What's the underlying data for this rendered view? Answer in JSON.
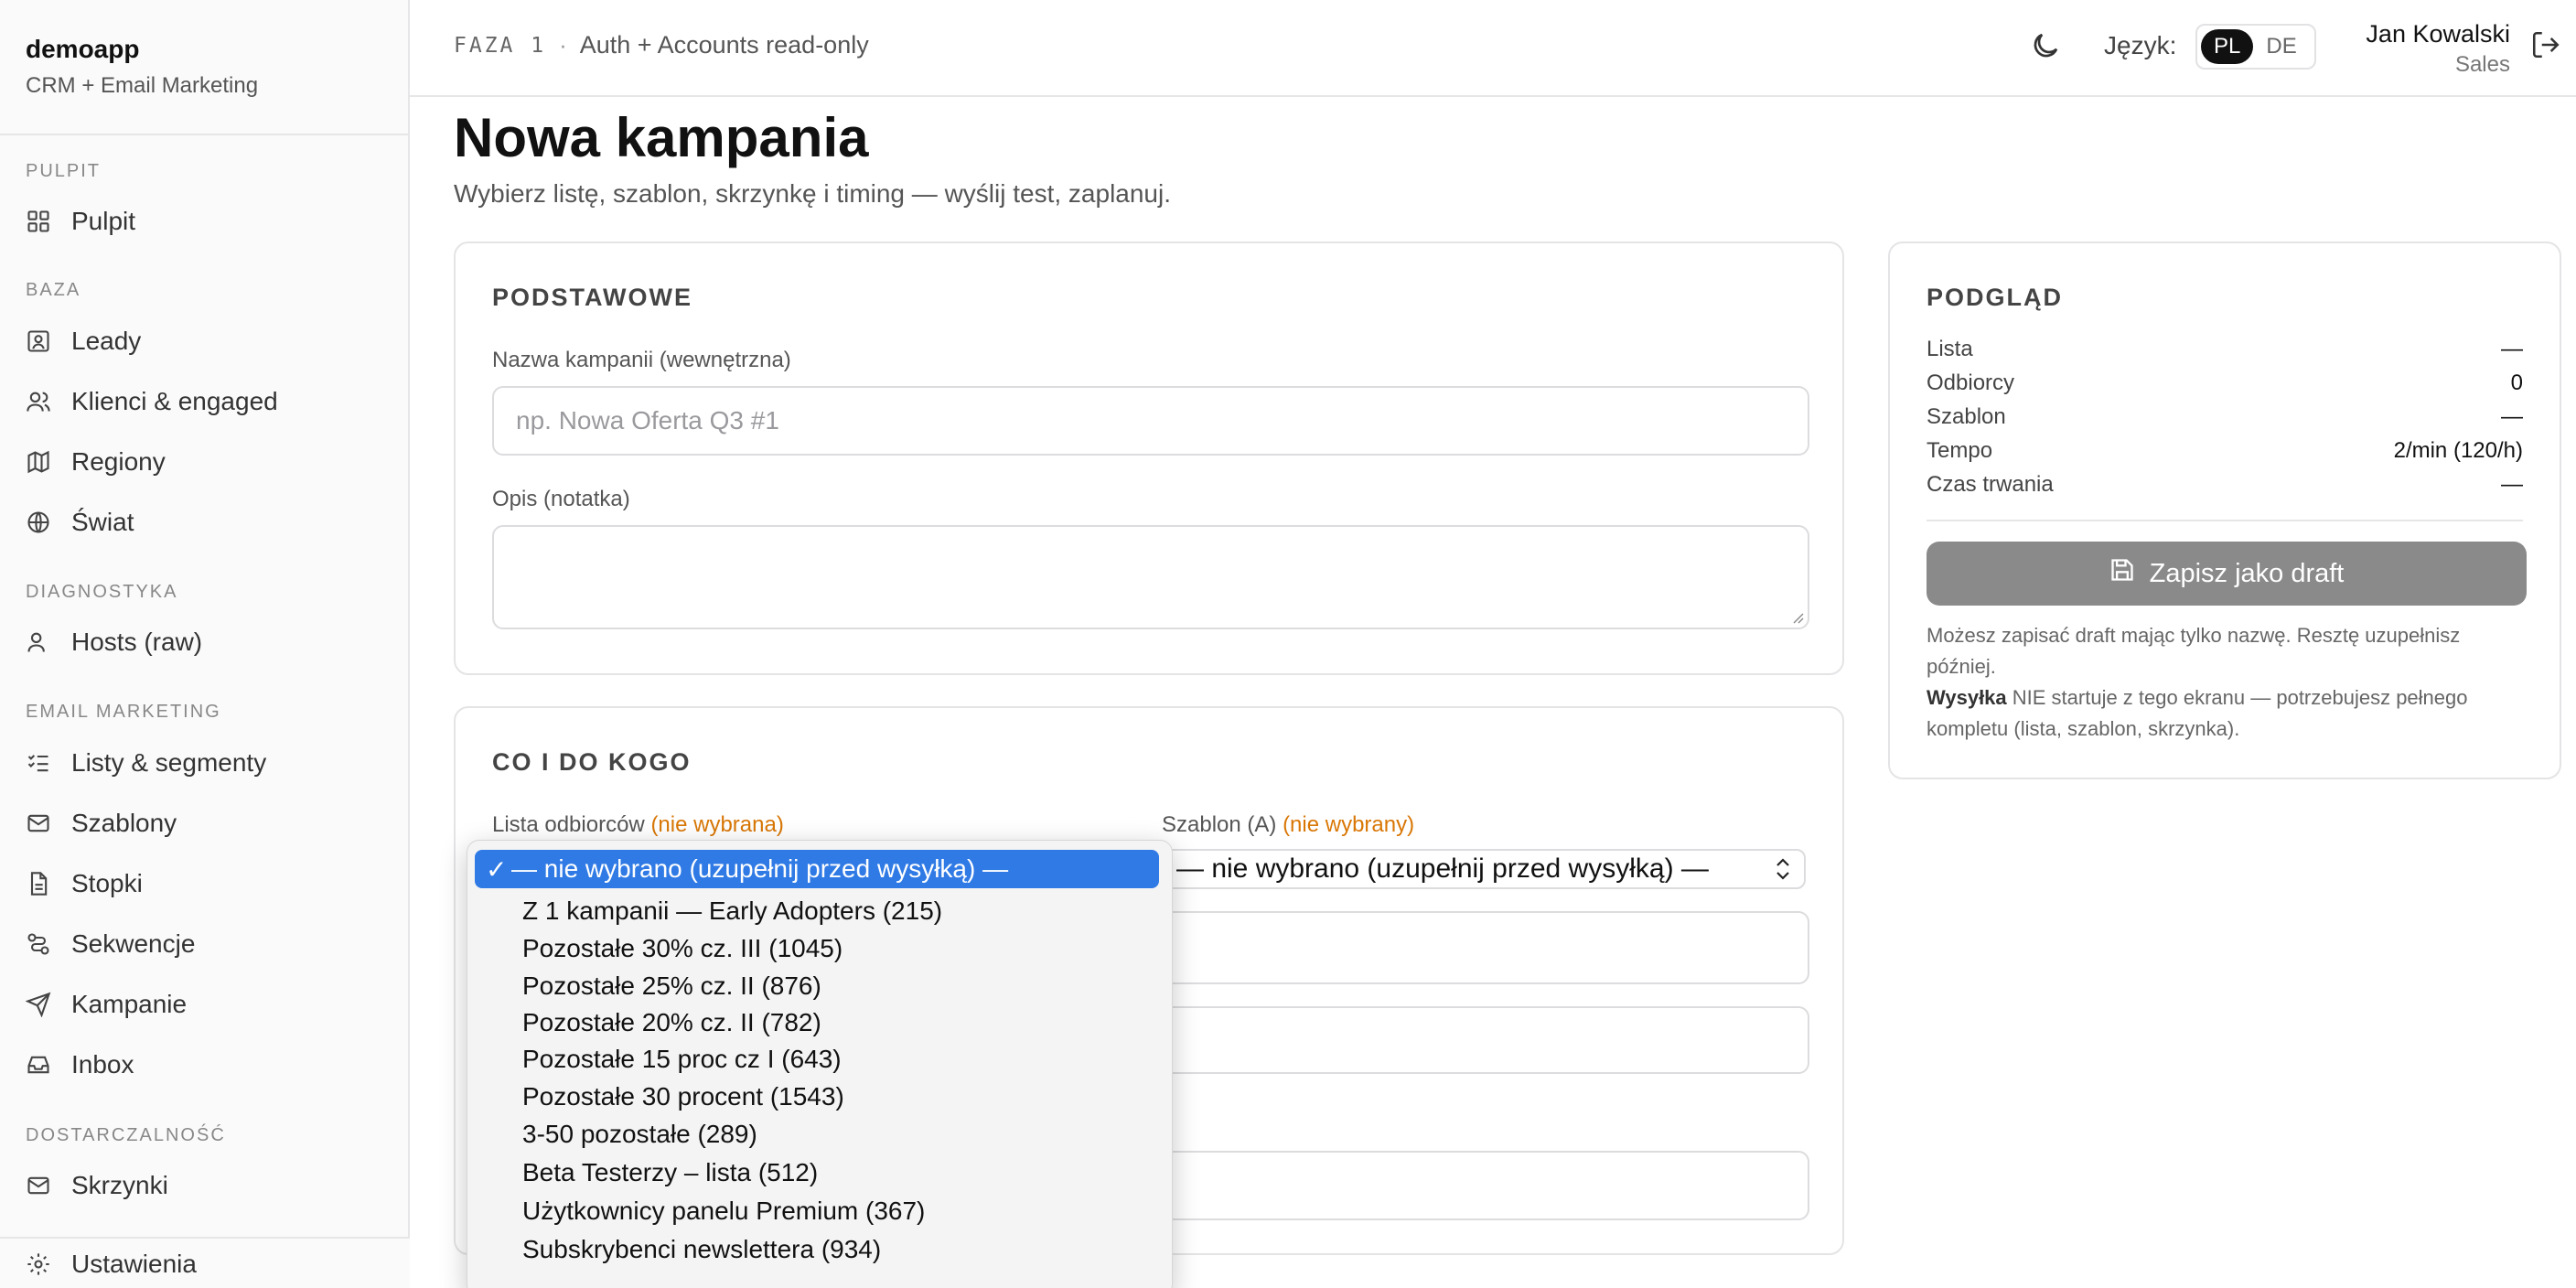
{
  "brand": {
    "name": "demoapp",
    "subtitle": "CRM + Email Marketing"
  },
  "sidebar": {
    "sections": [
      "Pulpit",
      "Baza",
      "Diagnostyka",
      "Email Marketing",
      "Dostarczalność"
    ],
    "items": [
      {
        "label": "Pulpit",
        "icon": "grid-icon"
      },
      {
        "label": "Leady",
        "icon": "contact-icon"
      },
      {
        "label": "Klienci & engaged",
        "icon": "users-icon"
      },
      {
        "label": "Regiony",
        "icon": "map-icon"
      },
      {
        "label": "Świat",
        "icon": "globe-icon"
      },
      {
        "label": "Hosts (raw)",
        "icon": "user-icon"
      },
      {
        "label": "Listy & segmenty",
        "icon": "list-check-icon"
      },
      {
        "label": "Szablony",
        "icon": "mail-icon"
      },
      {
        "label": "Stopki",
        "icon": "file-icon"
      },
      {
        "label": "Sekwencje",
        "icon": "route-icon"
      },
      {
        "label": "Kampanie",
        "icon": "send-icon"
      },
      {
        "label": "Inbox",
        "icon": "inbox-icon"
      },
      {
        "label": "Skrzynki",
        "icon": "mail-icon"
      }
    ],
    "footer": {
      "label": "Ustawienia",
      "icon": "gear-icon"
    }
  },
  "topbar": {
    "phase_code": "FAZA 1",
    "phase_sep": "·",
    "phase_desc": "Auth + Accounts read-only",
    "lang_label": "Język:",
    "langs": [
      "PL",
      "DE"
    ],
    "active_lang": "PL",
    "user_name": "Jan Kowalski",
    "user_role": "Sales"
  },
  "page": {
    "title": "Nowa kampania",
    "subtitle": "Wybierz listę, szablon, skrzynkę i timing — wyślij test, zaplanuj."
  },
  "basics": {
    "title": "Podstawowe",
    "name_label": "Nazwa kampanii (wewnętrzna)",
    "name_placeholder": "np. Nowa Oferta Q3 #1",
    "name_value": "",
    "desc_label": "Opis (notatka)",
    "desc_value": ""
  },
  "targeting": {
    "title": "Co i do kogo",
    "list_label": "Lista odbiorców",
    "list_status": "(nie wybrana)",
    "template_label": "Szablon (A)",
    "template_status": "(nie wybrany)",
    "template_value": "— nie wybrano (uzupełnij przed wysyłką) —"
  },
  "preview": {
    "title": "Podgląd",
    "rows": [
      {
        "k": "Lista",
        "v": "—"
      },
      {
        "k": "Odbiorcy",
        "v": "0"
      },
      {
        "k": "Szablon",
        "v": "—"
      },
      {
        "k": "Tempo",
        "v": "2/min (120/h)"
      },
      {
        "k": "Czas trwania",
        "v": "—"
      }
    ],
    "draft_button": "Zapisz jako draft",
    "note1": "Możesz zapisać draft mając tylko nazwę. Resztę uzupełnisz później.",
    "note2_bold": "Wysyłka",
    "note2": " NIE startuje z tego ekranu — potrzebujesz pełnego kompletu (lista, szablon, skrzynka)."
  },
  "dropdown": {
    "options": [
      "— nie wybrano (uzupełnij przed wysyłką) —",
      "Z 1 kampanii — Early Adopters (215)",
      "Pozostałe 30% cz. III (1045)",
      "Pozostałe 25% cz. II (876)",
      "Pozostałe 20% cz. II (782)",
      "Pozostałe 15 proc cz I (643)",
      "Pozostałe 30 procent (1543)",
      "3-50 pozostałe (289)",
      "Beta Testerzy – lista (512)",
      "Użytkownicy panelu Premium (367)",
      "Subskrybenci newslettera (934)"
    ],
    "selected_index": 0,
    "check": "✓"
  },
  "colors": {
    "accent": "#2f7ae5",
    "warn": "#d97706",
    "disabled_button": "#8a8a8a"
  }
}
